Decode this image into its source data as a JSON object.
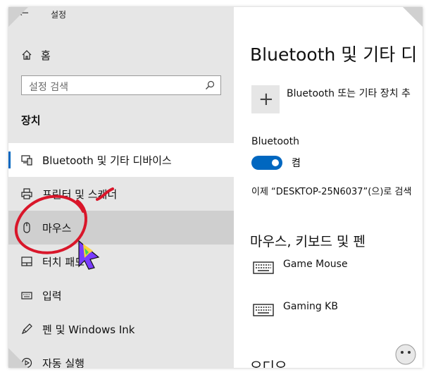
{
  "window": {
    "app_title": "설정"
  },
  "sidebar": {
    "home_label": "홈",
    "search_placeholder": "설정 검색",
    "section_title": "장치",
    "items": [
      {
        "label": "Bluetooth 및 기타 디바이스",
        "icon": "bluetooth-devices-icon"
      },
      {
        "label": "프린터 및 스캐너",
        "icon": "printer-icon"
      },
      {
        "label": "마우스",
        "icon": "mouse-icon"
      },
      {
        "label": "터치 패드",
        "icon": "touchpad-icon"
      },
      {
        "label": "입력",
        "icon": "keyboard-icon"
      },
      {
        "label": "펜 및 Windows Ink",
        "icon": "pen-icon"
      },
      {
        "label": "자동 실행",
        "icon": "autoplay-icon"
      }
    ]
  },
  "main": {
    "title": "Bluetooth 및 기타 디",
    "add_label": "Bluetooth 또는 기타 장치 추",
    "bluetooth_label": "Bluetooth",
    "toggle_state": "켬",
    "discoverable_text": "이제 “DESKTOP-25N6037”(으)로 검색",
    "section_mkp": "마우스, 키보드 및 펜",
    "devices": [
      {
        "name": "Game Mouse",
        "icon": "keyboard-icon"
      },
      {
        "name": "Gaming KB",
        "icon": "keyboard-icon"
      }
    ],
    "section_audio": "오디오"
  },
  "colors": {
    "accent": "#0067c0",
    "sidebar_bg": "#e6e6e6",
    "annotation": "#d9162a"
  }
}
